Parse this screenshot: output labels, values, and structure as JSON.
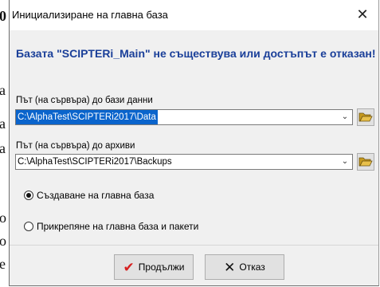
{
  "background": {
    "fragments": [
      "0",
      "a",
      "a",
      "a",
      "o",
      "o",
      "e"
    ]
  },
  "dialog": {
    "title": "Инициализиране на главна база",
    "banner": "Базата \"SCIPTERi_Main\" не съществува или достъпът е отказан!",
    "data_path": {
      "label": "Път (на сървъра) до бази данни",
      "value": "C:\\AlphaTest\\SCIPTERi2017\\Data"
    },
    "backup_path": {
      "label": "Път (на сървъра) до архиви",
      "value": "C:\\AlphaTest\\SCIPTERi2017\\Backups"
    },
    "options": [
      {
        "label": "Създаване на главна база",
        "selected": true
      },
      {
        "label": "Прикрепяне на главна база и пакети",
        "selected": false
      }
    ],
    "buttons": {
      "continue": "Продължи",
      "cancel": "Отказ"
    }
  },
  "colors": {
    "banner": "#1a3f99",
    "selection": "#0a64cc",
    "check": "#d62020",
    "folder": "#e8c04a"
  },
  "icons": [
    "close-icon",
    "chevron-down-icon",
    "folder-open-icon",
    "checkmark-icon",
    "x-mark-icon"
  ]
}
